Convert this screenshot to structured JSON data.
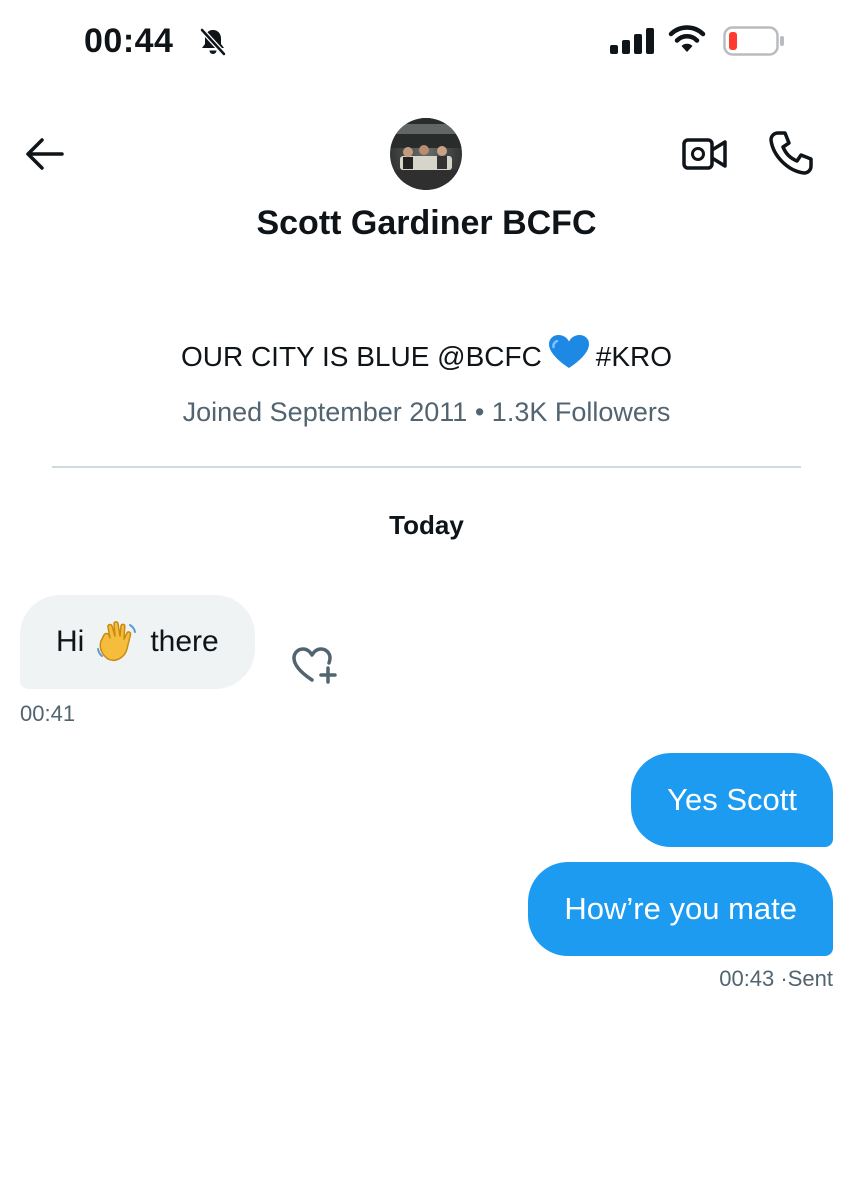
{
  "status_bar": {
    "time": "00:44"
  },
  "header": {
    "contact_name": "Scott Gardiner BCFC",
    "bio_text": "OUR CITY IS BLUE @BCFC",
    "bio_tag": "#KRO",
    "joined": "Joined September 2011",
    "followers": "1.3K Followers"
  },
  "chat": {
    "day_label": "Today",
    "messages": [
      {
        "direction": "in",
        "text_before": "Hi",
        "text_after": "there",
        "time": "00:41"
      },
      {
        "direction": "out",
        "text": "Yes Scott"
      },
      {
        "direction": "out",
        "text": "How’re you mate",
        "time": "00:43",
        "status": "Sent"
      }
    ]
  },
  "colors": {
    "accent": "#1d9bf0",
    "incoming_bubble": "#eff3f4",
    "muted_text": "#536471"
  }
}
